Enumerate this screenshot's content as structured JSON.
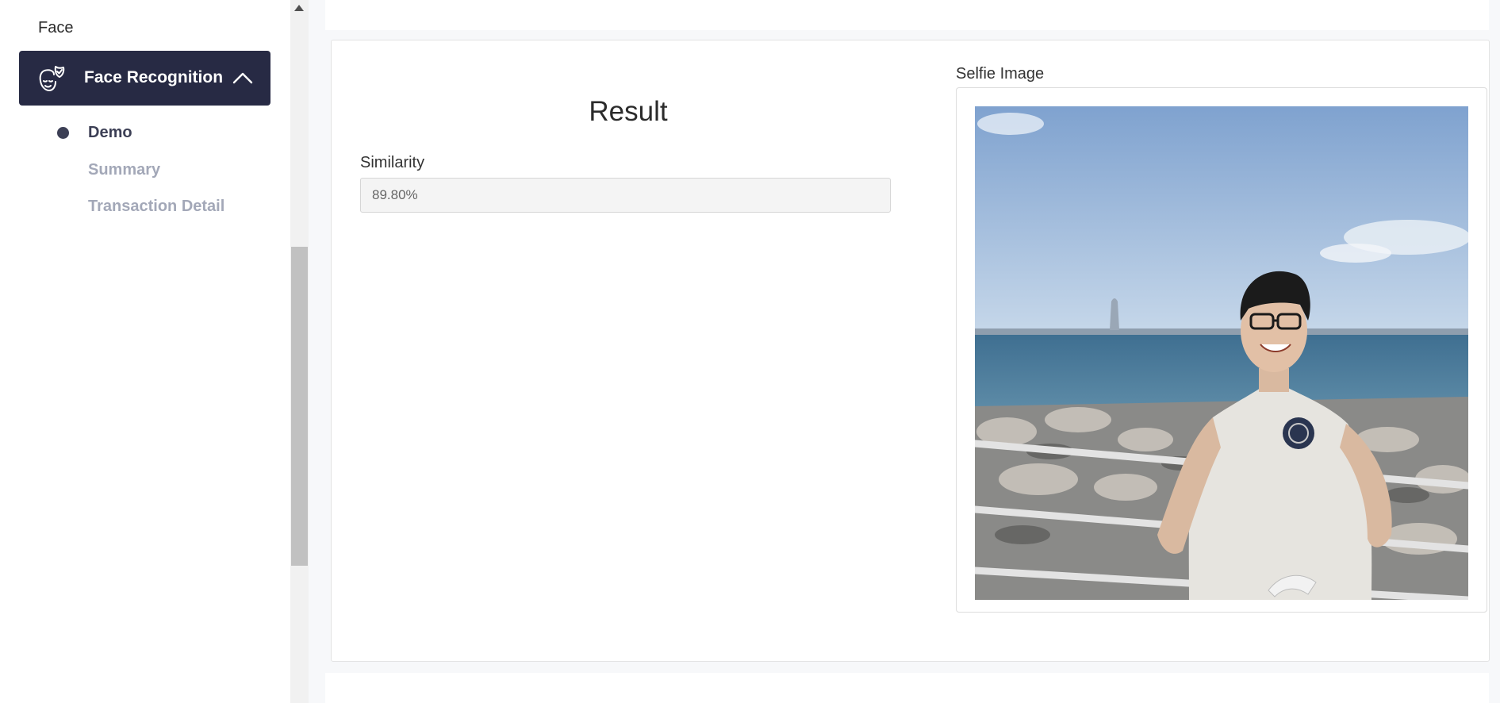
{
  "sidebar": {
    "section_label": "Face",
    "active_item": {
      "label": "Face Recognition",
      "icon": "face-shield-icon",
      "expanded_icon": "chevron-up-icon"
    },
    "sub_items": [
      {
        "label": "Demo",
        "active": true
      },
      {
        "label": "Summary",
        "active": false
      },
      {
        "label": "Transaction Detail",
        "active": false
      }
    ]
  },
  "result": {
    "title": "Result",
    "similarity_label": "Similarity",
    "similarity_value": "89.80%"
  },
  "selfie": {
    "label": "Selfie Image",
    "description": "photo"
  },
  "colors": {
    "sidebar_active_bg": "#272a44",
    "submenu_active": "#3c3f55",
    "submenu_inactive": "#a3a8b8"
  }
}
